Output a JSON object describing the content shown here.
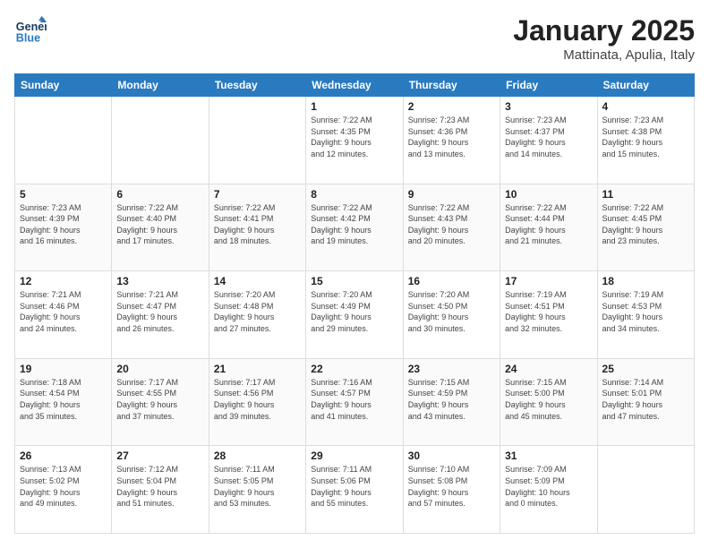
{
  "logo": {
    "line1": "General",
    "line2": "Blue"
  },
  "header": {
    "month": "January 2025",
    "location": "Mattinata, Apulia, Italy"
  },
  "weekdays": [
    "Sunday",
    "Monday",
    "Tuesday",
    "Wednesday",
    "Thursday",
    "Friday",
    "Saturday"
  ],
  "weeks": [
    [
      {
        "day": "",
        "info": ""
      },
      {
        "day": "",
        "info": ""
      },
      {
        "day": "",
        "info": ""
      },
      {
        "day": "1",
        "info": "Sunrise: 7:22 AM\nSunset: 4:35 PM\nDaylight: 9 hours\nand 12 minutes."
      },
      {
        "day": "2",
        "info": "Sunrise: 7:23 AM\nSunset: 4:36 PM\nDaylight: 9 hours\nand 13 minutes."
      },
      {
        "day": "3",
        "info": "Sunrise: 7:23 AM\nSunset: 4:37 PM\nDaylight: 9 hours\nand 14 minutes."
      },
      {
        "day": "4",
        "info": "Sunrise: 7:23 AM\nSunset: 4:38 PM\nDaylight: 9 hours\nand 15 minutes."
      }
    ],
    [
      {
        "day": "5",
        "info": "Sunrise: 7:23 AM\nSunset: 4:39 PM\nDaylight: 9 hours\nand 16 minutes."
      },
      {
        "day": "6",
        "info": "Sunrise: 7:22 AM\nSunset: 4:40 PM\nDaylight: 9 hours\nand 17 minutes."
      },
      {
        "day": "7",
        "info": "Sunrise: 7:22 AM\nSunset: 4:41 PM\nDaylight: 9 hours\nand 18 minutes."
      },
      {
        "day": "8",
        "info": "Sunrise: 7:22 AM\nSunset: 4:42 PM\nDaylight: 9 hours\nand 19 minutes."
      },
      {
        "day": "9",
        "info": "Sunrise: 7:22 AM\nSunset: 4:43 PM\nDaylight: 9 hours\nand 20 minutes."
      },
      {
        "day": "10",
        "info": "Sunrise: 7:22 AM\nSunset: 4:44 PM\nDaylight: 9 hours\nand 21 minutes."
      },
      {
        "day": "11",
        "info": "Sunrise: 7:22 AM\nSunset: 4:45 PM\nDaylight: 9 hours\nand 23 minutes."
      }
    ],
    [
      {
        "day": "12",
        "info": "Sunrise: 7:21 AM\nSunset: 4:46 PM\nDaylight: 9 hours\nand 24 minutes."
      },
      {
        "day": "13",
        "info": "Sunrise: 7:21 AM\nSunset: 4:47 PM\nDaylight: 9 hours\nand 26 minutes."
      },
      {
        "day": "14",
        "info": "Sunrise: 7:20 AM\nSunset: 4:48 PM\nDaylight: 9 hours\nand 27 minutes."
      },
      {
        "day": "15",
        "info": "Sunrise: 7:20 AM\nSunset: 4:49 PM\nDaylight: 9 hours\nand 29 minutes."
      },
      {
        "day": "16",
        "info": "Sunrise: 7:20 AM\nSunset: 4:50 PM\nDaylight: 9 hours\nand 30 minutes."
      },
      {
        "day": "17",
        "info": "Sunrise: 7:19 AM\nSunset: 4:51 PM\nDaylight: 9 hours\nand 32 minutes."
      },
      {
        "day": "18",
        "info": "Sunrise: 7:19 AM\nSunset: 4:53 PM\nDaylight: 9 hours\nand 34 minutes."
      }
    ],
    [
      {
        "day": "19",
        "info": "Sunrise: 7:18 AM\nSunset: 4:54 PM\nDaylight: 9 hours\nand 35 minutes."
      },
      {
        "day": "20",
        "info": "Sunrise: 7:17 AM\nSunset: 4:55 PM\nDaylight: 9 hours\nand 37 minutes."
      },
      {
        "day": "21",
        "info": "Sunrise: 7:17 AM\nSunset: 4:56 PM\nDaylight: 9 hours\nand 39 minutes."
      },
      {
        "day": "22",
        "info": "Sunrise: 7:16 AM\nSunset: 4:57 PM\nDaylight: 9 hours\nand 41 minutes."
      },
      {
        "day": "23",
        "info": "Sunrise: 7:15 AM\nSunset: 4:59 PM\nDaylight: 9 hours\nand 43 minutes."
      },
      {
        "day": "24",
        "info": "Sunrise: 7:15 AM\nSunset: 5:00 PM\nDaylight: 9 hours\nand 45 minutes."
      },
      {
        "day": "25",
        "info": "Sunrise: 7:14 AM\nSunset: 5:01 PM\nDaylight: 9 hours\nand 47 minutes."
      }
    ],
    [
      {
        "day": "26",
        "info": "Sunrise: 7:13 AM\nSunset: 5:02 PM\nDaylight: 9 hours\nand 49 minutes."
      },
      {
        "day": "27",
        "info": "Sunrise: 7:12 AM\nSunset: 5:04 PM\nDaylight: 9 hours\nand 51 minutes."
      },
      {
        "day": "28",
        "info": "Sunrise: 7:11 AM\nSunset: 5:05 PM\nDaylight: 9 hours\nand 53 minutes."
      },
      {
        "day": "29",
        "info": "Sunrise: 7:11 AM\nSunset: 5:06 PM\nDaylight: 9 hours\nand 55 minutes."
      },
      {
        "day": "30",
        "info": "Sunrise: 7:10 AM\nSunset: 5:08 PM\nDaylight: 9 hours\nand 57 minutes."
      },
      {
        "day": "31",
        "info": "Sunrise: 7:09 AM\nSunset: 5:09 PM\nDaylight: 10 hours\nand 0 minutes."
      },
      {
        "day": "",
        "info": ""
      }
    ]
  ]
}
